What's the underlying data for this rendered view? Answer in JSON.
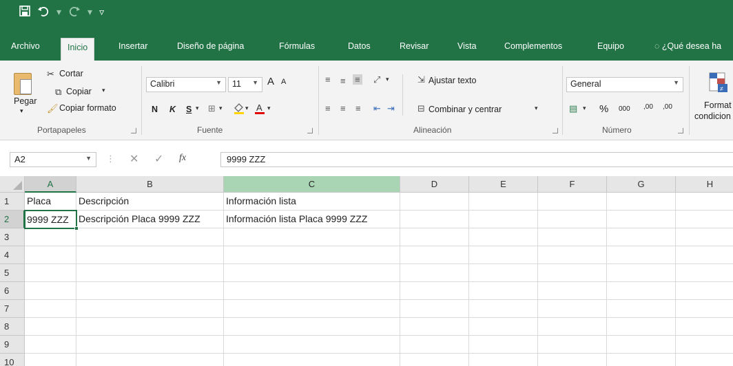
{
  "quick_access": {
    "save_icon": "save-icon",
    "undo_icon": "undo-icon",
    "redo_icon": "redo-icon",
    "customize_icon": "customize-icon"
  },
  "tabs": [
    "Archivo",
    "Inicio",
    "Insertar",
    "Diseño de página",
    "Fórmulas",
    "Datos",
    "Revisar",
    "Vista",
    "Complementos",
    "Equipo"
  ],
  "active_tab": "Inicio",
  "tell_me": "¿Qué desea ha",
  "ribbon": {
    "clipboard": {
      "paste": "Pegar",
      "cut": "Cortar",
      "copy": "Copiar",
      "format_painter": "Copiar formato",
      "label": "Portapapeles"
    },
    "font": {
      "family": "Calibri",
      "size": "11",
      "bold": "N",
      "italic": "K",
      "underline": "S",
      "grow": "A",
      "shrink": "A",
      "label": "Fuente"
    },
    "alignment": {
      "wrap": "Ajustar texto",
      "merge": "Combinar y centrar",
      "label": "Alineación"
    },
    "number": {
      "format": "General",
      "percent": "%",
      "thousands": "000",
      "inc_decimals": ",00",
      "dec_decimals": ",00",
      "label": "Número"
    },
    "styles": {
      "conditional_line1": "Format",
      "conditional_line2": "condicion"
    }
  },
  "formula_bar": {
    "name_box": "A2",
    "fx": "fx",
    "value": "9999 ZZZ"
  },
  "sheet": {
    "columns": [
      "A",
      "B",
      "C",
      "D",
      "E",
      "F",
      "G",
      "H"
    ],
    "rows": [
      "1",
      "2",
      "3",
      "4",
      "5",
      "6",
      "7",
      "8",
      "9",
      "10"
    ],
    "cells": {
      "A1": "Placa",
      "B1": "Descripción",
      "C1": "Información lista",
      "A2": "9999 ZZZ",
      "B2": "Descripción Placa 9999 ZZZ",
      "C2": "Información lista Placa 9999 ZZZ"
    },
    "active_cell": "A2",
    "accent_color": "#217346",
    "highlight_color": "#a9d5b5"
  }
}
